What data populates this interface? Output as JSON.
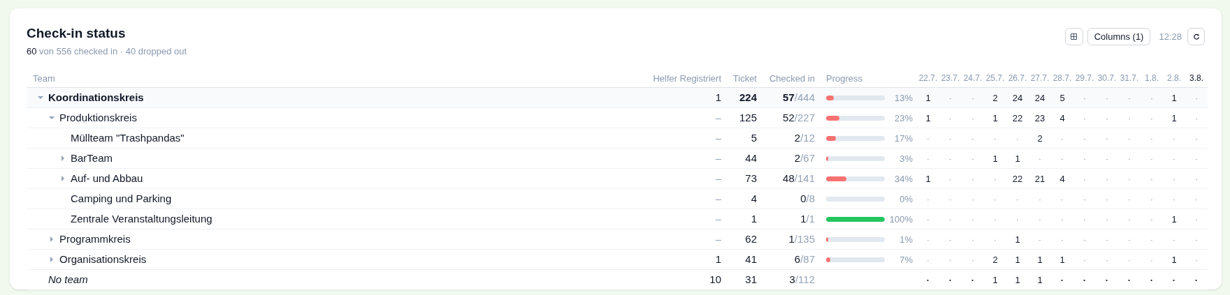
{
  "title": "Check-in status",
  "summary": {
    "count": "60",
    "text": "von 556 checked in · 40 dropped out"
  },
  "toolbar": {
    "columns_button": "Columns (1)",
    "time": "12:28"
  },
  "columns": {
    "team": "Team",
    "helpers": "Helfer Registriert",
    "ticket": "Ticket",
    "checked_in": "Checked in",
    "progress": "Progress"
  },
  "date_columns": [
    {
      "label": "22.7.",
      "highlighted": false
    },
    {
      "label": "23.7.",
      "highlighted": false
    },
    {
      "label": "24.7.",
      "highlighted": false
    },
    {
      "label": "25.7.",
      "highlighted": false
    },
    {
      "label": "26.7.",
      "highlighted": false
    },
    {
      "label": "27.7.",
      "highlighted": false
    },
    {
      "label": "28.7.",
      "highlighted": false
    },
    {
      "label": "29.7.",
      "highlighted": false
    },
    {
      "label": "30.7.",
      "highlighted": false
    },
    {
      "label": "31.7.",
      "highlighted": false
    },
    {
      "label": "1.8.",
      "highlighted": false
    },
    {
      "label": "2.8.",
      "highlighted": false
    },
    {
      "label": "3.8.",
      "highlighted": true
    }
  ],
  "rows": [
    {
      "kind": "team",
      "name": "Koordinationskreis",
      "expanded": true,
      "helpers": "1",
      "ticket": "224",
      "checked_in": "57",
      "total": "/444",
      "level": 0.13,
      "percent": "13%",
      "days": [
        "1",
        "·",
        "·",
        "2",
        "24",
        "24",
        "5",
        "·",
        "·",
        "·",
        "·",
        "1",
        "·"
      ],
      "children": [
        {
          "kind": "team",
          "name": "Produktionskreis",
          "expanded": true,
          "helpers": "–",
          "ticket": "125",
          "checked_in": "52",
          "total": "/227",
          "level": 0.23,
          "percent": "23%",
          "days": [
            "1",
            "·",
            "·",
            "1",
            "22",
            "23",
            "4",
            "·",
            "·",
            "·",
            "·",
            "1",
            "·"
          ],
          "children": [
            {
              "kind": "team",
              "name": "Müllteam \"Trashpandas\"",
              "helpers": "–",
              "ticket": "5",
              "checked_in": "2",
              "total": "/12",
              "level": 0.17,
              "percent": "17%",
              "days": [
                "·",
                "·",
                "·",
                "·",
                "·",
                "2",
                "·",
                "·",
                "·",
                "·",
                "·",
                "·",
                "·"
              ]
            },
            {
              "kind": "team",
              "name": "BarTeam",
              "expanded": false,
              "helpers": "–",
              "ticket": "44",
              "checked_in": "2",
              "total": "/67",
              "level": 0.03,
              "percent": "3%",
              "days": [
                "·",
                "·",
                "·",
                "1",
                "1",
                "·",
                "·",
                "·",
                "·",
                "·",
                "·",
                "·",
                "·"
              ]
            },
            {
              "kind": "team",
              "name": "Auf- und Abbau",
              "expanded": false,
              "helpers": "–",
              "ticket": "73",
              "checked_in": "48",
              "total": "/141",
              "level": 0.34,
              "percent": "34%",
              "days": [
                "1",
                "·",
                "·",
                "·",
                "22",
                "21",
                "4",
                "·",
                "·",
                "·",
                "·",
                "·",
                "·"
              ]
            },
            {
              "kind": "team",
              "name": "Camping und Parking",
              "helpers": "–",
              "ticket": "4",
              "checked_in": "0",
              "total": "/8",
              "level": 0,
              "percent": "0%",
              "days": [
                "·",
                "·",
                "·",
                "·",
                "·",
                "·",
                "·",
                "·",
                "·",
                "·",
                "·",
                "·",
                "·"
              ]
            },
            {
              "kind": "team",
              "name": "Zentrale Veranstaltungsleitung",
              "helpers": "–",
              "ticket": "1",
              "checked_in": "1",
              "total": "/1",
              "level": 1,
              "percent": "100%",
              "days": [
                "·",
                "·",
                "·",
                "·",
                "·",
                "·",
                "·",
                "·",
                "·",
                "·",
                "·",
                "1",
                "·"
              ]
            }
          ]
        },
        {
          "kind": "team",
          "name": "Programmkreis",
          "expanded": false,
          "helpers": "–",
          "ticket": "62",
          "checked_in": "1",
          "total": "/135",
          "level": 0.01,
          "percent": "1%",
          "days": [
            "·",
            "·",
            "·",
            "·",
            "1",
            "·",
            "·",
            "·",
            "·",
            "·",
            "·",
            "·",
            "·"
          ]
        },
        {
          "kind": "team",
          "name": "Organisationskreis",
          "expanded": false,
          "helpers": "1",
          "ticket": "41",
          "checked_in": "6",
          "total": "/87",
          "level": 0.07,
          "percent": "7%",
          "days": [
            "·",
            "·",
            "·",
            "2",
            "1",
            "1",
            "1",
            "·",
            "·",
            "·",
            "·",
            "1",
            "·"
          ]
        }
      ]
    },
    {
      "kind": "no_team",
      "name": "No team",
      "helpers": "10",
      "ticket": "31",
      "checked_in": "3",
      "total": "/112",
      "days": [
        "·",
        "·",
        "·",
        "1",
        "1",
        "1",
        "·",
        "·",
        "·",
        "·",
        "·",
        "·",
        "·"
      ]
    }
  ]
}
